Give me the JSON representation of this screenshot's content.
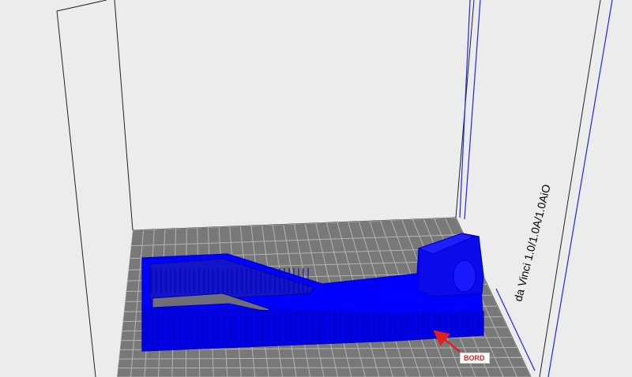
{
  "viewport": {
    "printer_name": "da Vinci 1.0/1.0A/1.0AiO",
    "background_color": "#ececec"
  },
  "build_plate": {
    "plate_color": "#787878",
    "grid_line_color": "#b4b4b4"
  },
  "model": {
    "color": "#0000ff",
    "edge_color": "#0000c8"
  },
  "annotation": {
    "label": "BORD",
    "color": "#e0201c",
    "icon": "red-arrow-icon"
  }
}
